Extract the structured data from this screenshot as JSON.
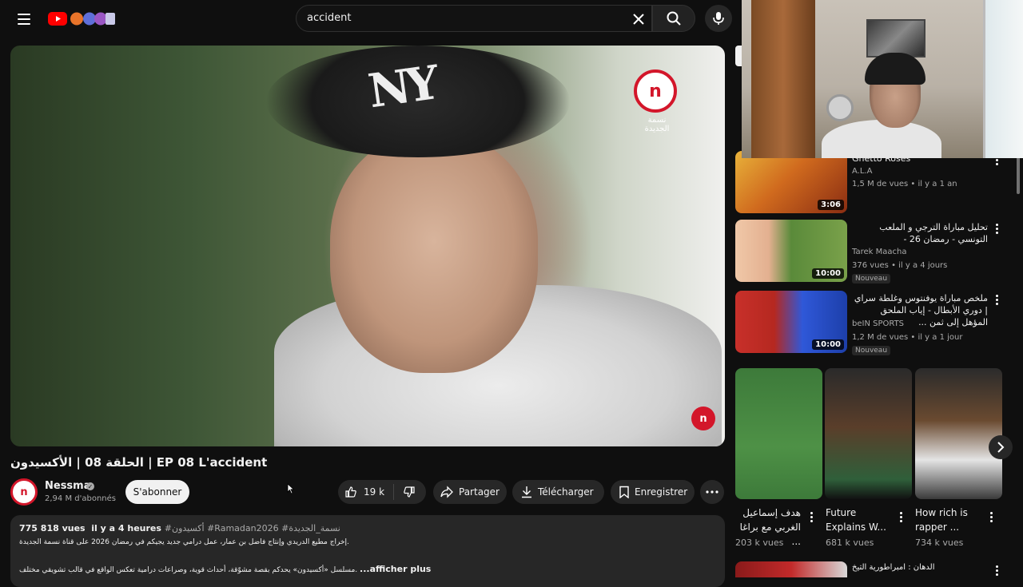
{
  "header": {
    "search_value": "accident"
  },
  "video": {
    "title": "الحلقة 08 | الأكسيدون | EP 08 L'accident",
    "brand_sub": "نسمة الجديدة",
    "channel_name": "Nessma",
    "subscribers": "2,94 M d'abonnés",
    "subscribe_label": "S'abonner",
    "likes": "19 k",
    "share_label": "Partager",
    "download_label": "Télécharger",
    "save_label": "Enregistrer"
  },
  "description": {
    "views": "775 818 vues",
    "age": "il y a 4 heures",
    "hashtags": "#أكسيدون #Ramadan2026 #نسمة_الجديدة",
    "line1": "إخراج مطيع الدريدي وإنتاج فاضل بن عمار، عمل درامي جديد يجيكم في رمضان 2026 على قناة نسمة الجديدة.",
    "line2": "مسلسل «أكسيدون» يحدكم بقصة مشوّقة، أحداث قوية، وصراعات درامية تعكس الواقع في قالب تشويقي مختلف.",
    "more_label": "...afficher plus"
  },
  "sidebar": [
    {
      "title": "Ghetto Roses",
      "channel": "A.L.A",
      "meta": "1,5 M de vues • il y a 1 an",
      "duration": "3:06",
      "badge": ""
    },
    {
      "title": "تحليل مباراة الترجي و الملعب التونسي - رمضان 26 -",
      "channel": "Tarek Maacha",
      "meta": "376 vues • il y a 4 jours",
      "duration": "10:00",
      "badge": "Nouveau"
    },
    {
      "title": "ملخص مباراة يوفنتوس وغلطة سراي | دوري الأبطال - إياب الملحق المؤهل إلى ثمن ...",
      "channel": "beIN SPORTS",
      "meta": "1,2 M de vues • il y a 1 jour",
      "duration": "10:00",
      "badge": "Nouveau"
    }
  ],
  "shorts": [
    {
      "title": "هدف إسماعيل الغربي مع براغا ...",
      "views": "203 k vues"
    },
    {
      "title": "Future Explains W...",
      "views": "681 k vues"
    },
    {
      "title": "How rich is rapper ...",
      "views": "734 k vues"
    }
  ],
  "next_item": {
    "title": "الدهان : امبراطورية التيخ"
  },
  "colors": {
    "background": "#0f0f0f",
    "brand_red": "#d3162a",
    "pill": "#272727"
  }
}
